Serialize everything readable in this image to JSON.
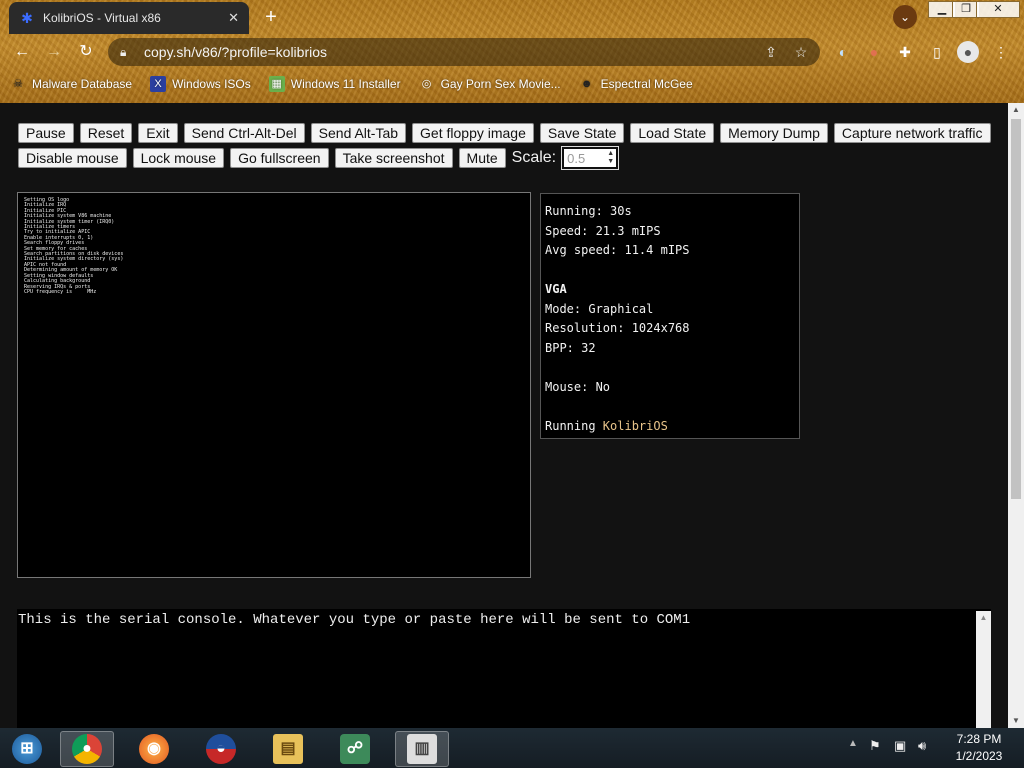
{
  "browser": {
    "tab_title": "KolibriOS - Virtual x86",
    "url": "copy.sh/v86/?profile=kolibrios",
    "bookmarks": [
      {
        "label": "Malware Database",
        "icon": "skull-icon"
      },
      {
        "label": "Windows ISOs",
        "icon": "x-icon"
      },
      {
        "label": "Windows 11 Installer",
        "icon": "image-icon"
      },
      {
        "label": "Gay Porn Sex Movie...",
        "icon": "globe-icon"
      },
      {
        "label": "Espectral McGee",
        "icon": "avatar-icon"
      }
    ]
  },
  "controls": {
    "row1": [
      "Pause",
      "Reset",
      "Exit",
      "Send Ctrl-Alt-Del",
      "Send Alt-Tab",
      "Get floppy image",
      "Save State",
      "Load State",
      "Memory Dump",
      "Capture network traffic"
    ],
    "row2": [
      "Disable mouse",
      "Lock mouse",
      "Go fullscreen",
      "Take screenshot",
      "Mute"
    ],
    "scale_label": "Scale:",
    "scale_value": "0.5"
  },
  "screen": {
    "boot_log": [
      "Setting OS logo",
      "Initialize IRQ",
      "Initialize PIC",
      "Initialize system V86 machine",
      "Initialize system timer (IRQ0)",
      "Initialize timers",
      "Try to initialize APIC",
      "Enable interrupts 0, 1)",
      "Search floppy drives",
      "Set memory for caches",
      "Search partitions on disk devices",
      "Initialize system directory (sys)",
      "APIC not found",
      "Determining amount of memory OK",
      "Setting window defaults",
      "Calculating background",
      "Reserving IRQs & ports",
      "CPU frequency is     MHz"
    ]
  },
  "stats": {
    "running": "Running: 30s",
    "speed": "Speed: 21.3 mIPS",
    "avg_speed": "Avg speed: 11.4 mIPS",
    "vga_heading": "VGA",
    "mode": "Mode: Graphical",
    "resolution": "Resolution: 1024x768",
    "bpp": "BPP: 32",
    "mouse": "Mouse: No",
    "running_prefix": "Running ",
    "os_name": "KolibriOS"
  },
  "serial": {
    "text": "This is the serial console. Whatever you type or paste here will be sent to COM1"
  },
  "taskbar": {
    "apps": [
      "start-orb",
      "chrome",
      "firefox",
      "obama",
      "file-explorer",
      "network-app",
      "archive"
    ],
    "time": "7:28 PM",
    "date": "1/2/2023"
  }
}
